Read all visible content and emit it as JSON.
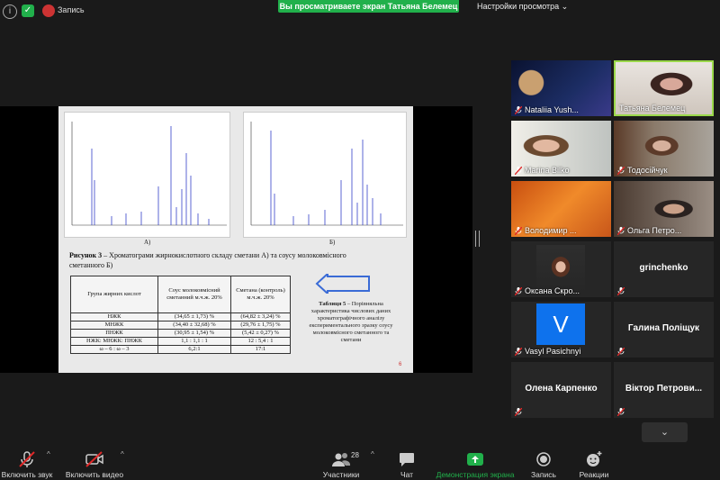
{
  "topbar": {
    "record_label": "Запись",
    "share_banner": "Вы просматриваете экран Татьяна Белемец",
    "view_settings": "Настройки просмотра"
  },
  "slide": {
    "chart_a_label": "А)",
    "chart_b_label": "Б)",
    "caption_bold": "Рисунок 3",
    "caption_text": " – Хроматограми жирнокислотного складу  сметани А) та  соусу молоковмісного сметанного Б)",
    "table": {
      "headers": [
        "Група жирних кислот",
        "Соус молоковмісний сметанний м.ч.ж. 20%",
        "Сметана (контроль) м.ч.ж. 20%"
      ],
      "rows": [
        [
          "НЖК",
          "(34,65 ± 1,73) %",
          "(64,82 ± 3,24) %"
        ],
        [
          "МНЖК",
          "(34,40 ± 32,68) %",
          "(29,76 ± 1,75) %"
        ],
        [
          "ПНЖК",
          "(30,95 ± 1,54) %",
          "(5,42 ± 0,27) %"
        ],
        [
          "НЖК: МНЖК: ПНЖК",
          "1,1 : 1,1 : 1",
          "12 : 5,4 : 1"
        ],
        [
          "ω – 6 : ω – 3",
          "6,2:1",
          "17:1"
        ]
      ]
    },
    "table5_bold": "Таблиця 5",
    "table5_text": " – Порівняльна характеристика числових даних хроматографічного аналізу експериментального зразку соусу молоковмісного сметанного та сметани",
    "page_number": "6"
  },
  "participants": [
    {
      "name": "Nataliia Yush...",
      "muted": true,
      "video": true
    },
    {
      "name": "Татьяна Белемец",
      "muted": false,
      "video": true,
      "active": true
    },
    {
      "name": "Marina Bilko",
      "muted": true,
      "video": true
    },
    {
      "name": "Тодосійчук",
      "muted": true,
      "video": true
    },
    {
      "name": "Володимир ...",
      "muted": true,
      "video": true
    },
    {
      "name": "Ольга Петро...",
      "muted": true,
      "video": true
    },
    {
      "name": "Оксана Скро...",
      "muted": true,
      "video": true
    },
    {
      "name": "grinchenko",
      "muted": true,
      "video": false
    },
    {
      "name": "Vasyl Pasichnyi",
      "muted": true,
      "video": false,
      "avatar_letter": "V"
    },
    {
      "name": "Галина Поліщук",
      "muted": true,
      "video": false
    },
    {
      "name": "Олена Карпенко",
      "muted": true,
      "video": false
    },
    {
      "name": "Віктор  Петрови...",
      "muted": true,
      "video": false
    }
  ],
  "toolbar": {
    "audio": "Включить звук",
    "video": "Включить видео",
    "participants": "Участники",
    "participants_count": "28",
    "chat": "Чат",
    "share": "Демонстрация экрана",
    "record": "Запись",
    "reactions": "Реакции"
  },
  "colors": {
    "share_green": "#21b04b",
    "active_border": "#9ad84a",
    "mute_red": "#e02828",
    "avatar_blue": "#0e72ed"
  }
}
